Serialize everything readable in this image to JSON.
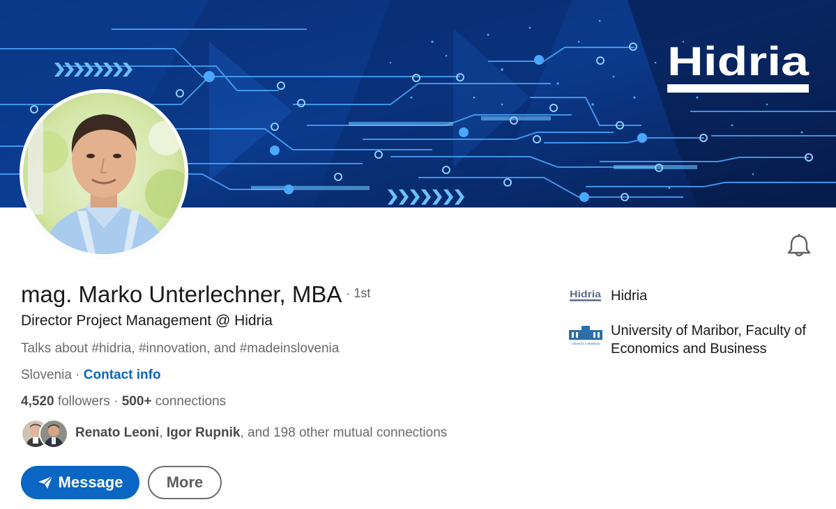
{
  "banner": {
    "company_logo_text": "Hidria",
    "background_color": "#0b2a6b",
    "accent_color": "#3fa6ff"
  },
  "profile": {
    "name": "mag. Marko Unterlechner, MBA",
    "degree": "· 1st",
    "headline": "Director Project Management @ Hidria",
    "talks_about": "Talks about #hidria, #innovation, and #madeinslovenia",
    "location": "Slovenia",
    "location_sep": " · ",
    "contact_info_label": "Contact info"
  },
  "stats": {
    "followers_count": "4,520",
    "followers_label": "followers",
    "separator": " · ",
    "connections_count": "500+",
    "connections_label": "connections"
  },
  "mutual": {
    "person1": "Renato Leoni",
    "sep1": ", ",
    "person2": "Igor Rupnik",
    "rest": ", and 198 other mutual connections"
  },
  "actions": {
    "message_label": "Message",
    "more_label": "More",
    "message_icon": "paper-plane-icon",
    "notify_icon": "bell-icon",
    "primary_color": "#0a66c2"
  },
  "experience": {
    "company_name": "Hidria",
    "company_logo": "Hidria",
    "education_name": "University of Maribor, Faculty of Economics and Business",
    "education_logo_text": "Univerza v Mariboru"
  }
}
